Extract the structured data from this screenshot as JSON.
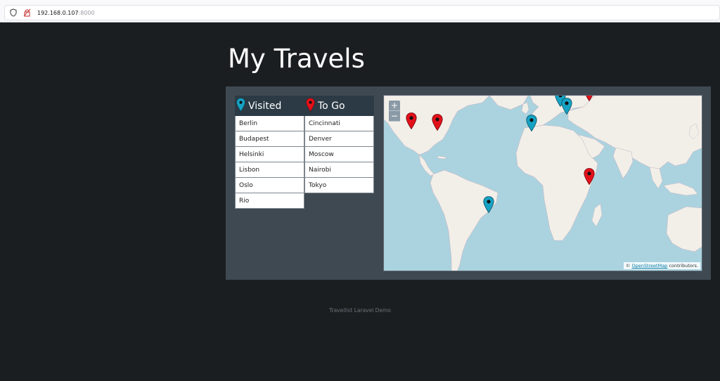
{
  "browser": {
    "url_host": "192.168.0.107",
    "url_port": ":8000"
  },
  "page": {
    "title": "My Travels"
  },
  "visited": {
    "label": "Visited",
    "color": "#16a2c4",
    "items": [
      "Berlin",
      "Budapest",
      "Helsinki",
      "Lisbon",
      "Oslo",
      "Rio"
    ]
  },
  "togo": {
    "label": "To Go",
    "color": "#e3101a",
    "items": [
      "Cincinnati",
      "Denver",
      "Moscow",
      "Nairobi",
      "Tokyo"
    ]
  },
  "map": {
    "zoom_in": "+",
    "zoom_out": "−",
    "attribution_prefix": "©",
    "attribution_link": "OpenStreetMap",
    "attribution_suffix": "contributors.",
    "markers": [
      {
        "city": "Denver",
        "type": "togo"
      },
      {
        "city": "Cincinnati",
        "type": "togo"
      },
      {
        "city": "Lisbon",
        "type": "visited"
      },
      {
        "city": "Oslo",
        "type": "visited"
      },
      {
        "city": "Berlin",
        "type": "visited"
      },
      {
        "city": "Helsinki",
        "type": "togo"
      },
      {
        "city": "Nairobi",
        "type": "togo"
      },
      {
        "city": "Rio",
        "type": "visited"
      }
    ]
  },
  "footer": {
    "text": "Travellist Laravel Demo"
  }
}
